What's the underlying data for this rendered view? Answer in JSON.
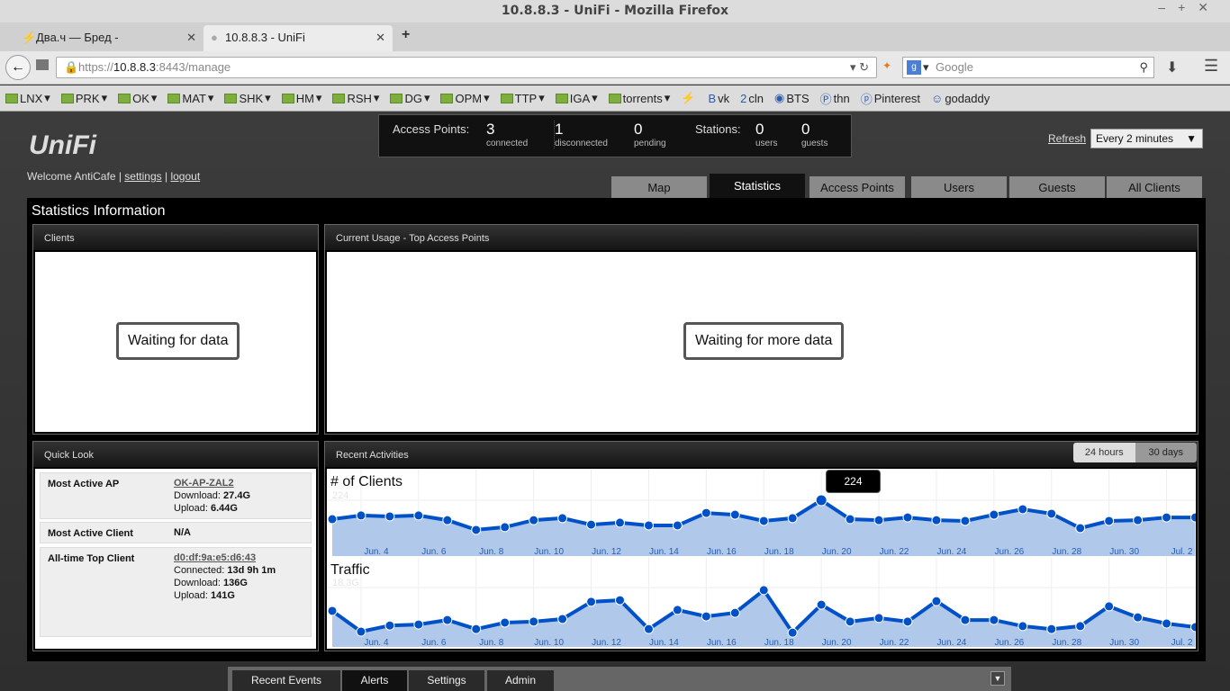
{
  "browser": {
    "window_title": "10.8.8.3 - UniFi - Mozilla Firefox",
    "tabs": [
      {
        "label": "Два.ч — Бред -"
      },
      {
        "label": "10.8.8.3 - UniFi"
      }
    ],
    "url_prefix": "https://",
    "url_host": "10.8.8.3",
    "url_rest": ":8443/manage",
    "search_placeholder": "Google",
    "bookmarks": [
      {
        "label": "LNX",
        "type": "folder"
      },
      {
        "label": "PRK",
        "type": "folder"
      },
      {
        "label": "OK",
        "type": "folder"
      },
      {
        "label": "MAT",
        "type": "folder"
      },
      {
        "label": "SHK",
        "type": "folder"
      },
      {
        "label": "HM",
        "type": "folder"
      },
      {
        "label": "RSH",
        "type": "folder"
      },
      {
        "label": "DG",
        "type": "folder"
      },
      {
        "label": "OPM",
        "type": "folder"
      },
      {
        "label": "TTP",
        "type": "folder"
      },
      {
        "label": "IGA",
        "type": "folder"
      },
      {
        "label": "torrents",
        "type": "folder"
      },
      {
        "label": "",
        "type": "link",
        "icon": "⚡"
      },
      {
        "label": "vk",
        "type": "link",
        "icon": "B"
      },
      {
        "label": "cln",
        "type": "link",
        "icon": "2"
      },
      {
        "label": "BTS",
        "type": "link",
        "icon": "◉"
      },
      {
        "label": "thn",
        "type": "link",
        "icon": "Ⓟ"
      },
      {
        "label": "Pinterest",
        "type": "link",
        "icon": "ⓟ"
      },
      {
        "label": "godaddy",
        "type": "link",
        "icon": "☺"
      }
    ]
  },
  "header": {
    "logo": "UniFi",
    "welcome": "Welcome AntiCafe",
    "settings": "settings",
    "logout": "logout",
    "refresh": "Refresh",
    "refresh_interval": "Every 2 minutes"
  },
  "stats": {
    "ap_label": "Access Points:",
    "connected": "3",
    "connected_label": "connected",
    "disconnected": "1",
    "disconnected_label": "disconnected",
    "pending": "0",
    "pending_label": "pending",
    "stations_label": "Stations:",
    "users": "0",
    "users_label": "users",
    "guests": "0",
    "guests_label": "guests"
  },
  "nav": {
    "tabs": [
      "Map",
      "Statistics",
      "Access Points",
      "Users",
      "Guests",
      "All Clients"
    ],
    "active": "Statistics"
  },
  "main": {
    "title": "Statistics Information",
    "clients_panel": {
      "title": "Clients",
      "message": "Waiting for data"
    },
    "usage_panel": {
      "title": "Current Usage - Top Access Points",
      "message": "Waiting for more data"
    },
    "quicklook": {
      "title": "Quick Look",
      "most_active_ap": {
        "label": "Most Active AP",
        "name": "OK-AP-ZAL2",
        "download_label": "Download:",
        "download": "27.4G",
        "upload_label": "Upload:",
        "upload": "6.44G"
      },
      "most_active_client": {
        "label": "Most Active Client",
        "value": "N/A"
      },
      "top_client": {
        "label": "All-time Top Client",
        "mac": "d0:df:9a:e5:d6:43",
        "connected_label": "Connected:",
        "connected": "13d 9h 1m",
        "download_label": "Download:",
        "download": "136G",
        "upload_label": "Upload:",
        "upload": "141G"
      }
    },
    "activities": {
      "title": "Recent Activities",
      "range_24h": "24 hours",
      "range_30d": "30 days",
      "tooltip": "224"
    }
  },
  "bottom": {
    "tabs": [
      "Recent Events",
      "Alerts",
      "Settings",
      "Admin"
    ]
  },
  "chart_data": [
    {
      "type": "area",
      "title": "# of Clients",
      "ymax_label": "224",
      "ylim": [
        0,
        224
      ],
      "x_labels": [
        "Jun. 4",
        "Jun. 6",
        "Jun. 8",
        "Jun. 10",
        "Jun. 12",
        "Jun. 14",
        "Jun. 16",
        "Jun. 18",
        "Jun. 20",
        "Jun. 22",
        "Jun. 24",
        "Jun. 26",
        "Jun. 28",
        "Jun. 30",
        "Jul. 2"
      ],
      "values": [
        148,
        163,
        159,
        163,
        144,
        105,
        116,
        144,
        152,
        126,
        134,
        123,
        123,
        173,
        166,
        141,
        152,
        224,
        148,
        144,
        155,
        144,
        141,
        166,
        188,
        170,
        112,
        141,
        144,
        155,
        155
      ],
      "color": "#0050c8",
      "fill": "#b0c8ea"
    },
    {
      "type": "area",
      "title": "Traffic",
      "ymax_label": "18.3G",
      "ylim": [
        0,
        18.3
      ],
      "x_labels": [
        "Jun. 4",
        "Jun. 6",
        "Jun. 8",
        "Jun. 10",
        "Jun. 12",
        "Jun. 14",
        "Jun. 16",
        "Jun. 18",
        "Jun. 20",
        "Jun. 22",
        "Jun. 24",
        "Jun. 26",
        "Jun. 28",
        "Jun. 30",
        "Jul. 2"
      ],
      "values": [
        11.1,
        4.7,
        6.6,
        6.9,
        8.3,
        5.5,
        7.5,
        7.8,
        8.6,
        13.9,
        14.4,
        5.5,
        11.4,
        9.4,
        10.5,
        17.5,
        4.4,
        13.0,
        7.8,
        8.9,
        7.8,
        14.1,
        8.3,
        8.3,
        6.4,
        5.5,
        6.4,
        12.5,
        9.1,
        7.2,
        6.1
      ],
      "color": "#0050c8",
      "fill": "#b0c8ea"
    }
  ]
}
